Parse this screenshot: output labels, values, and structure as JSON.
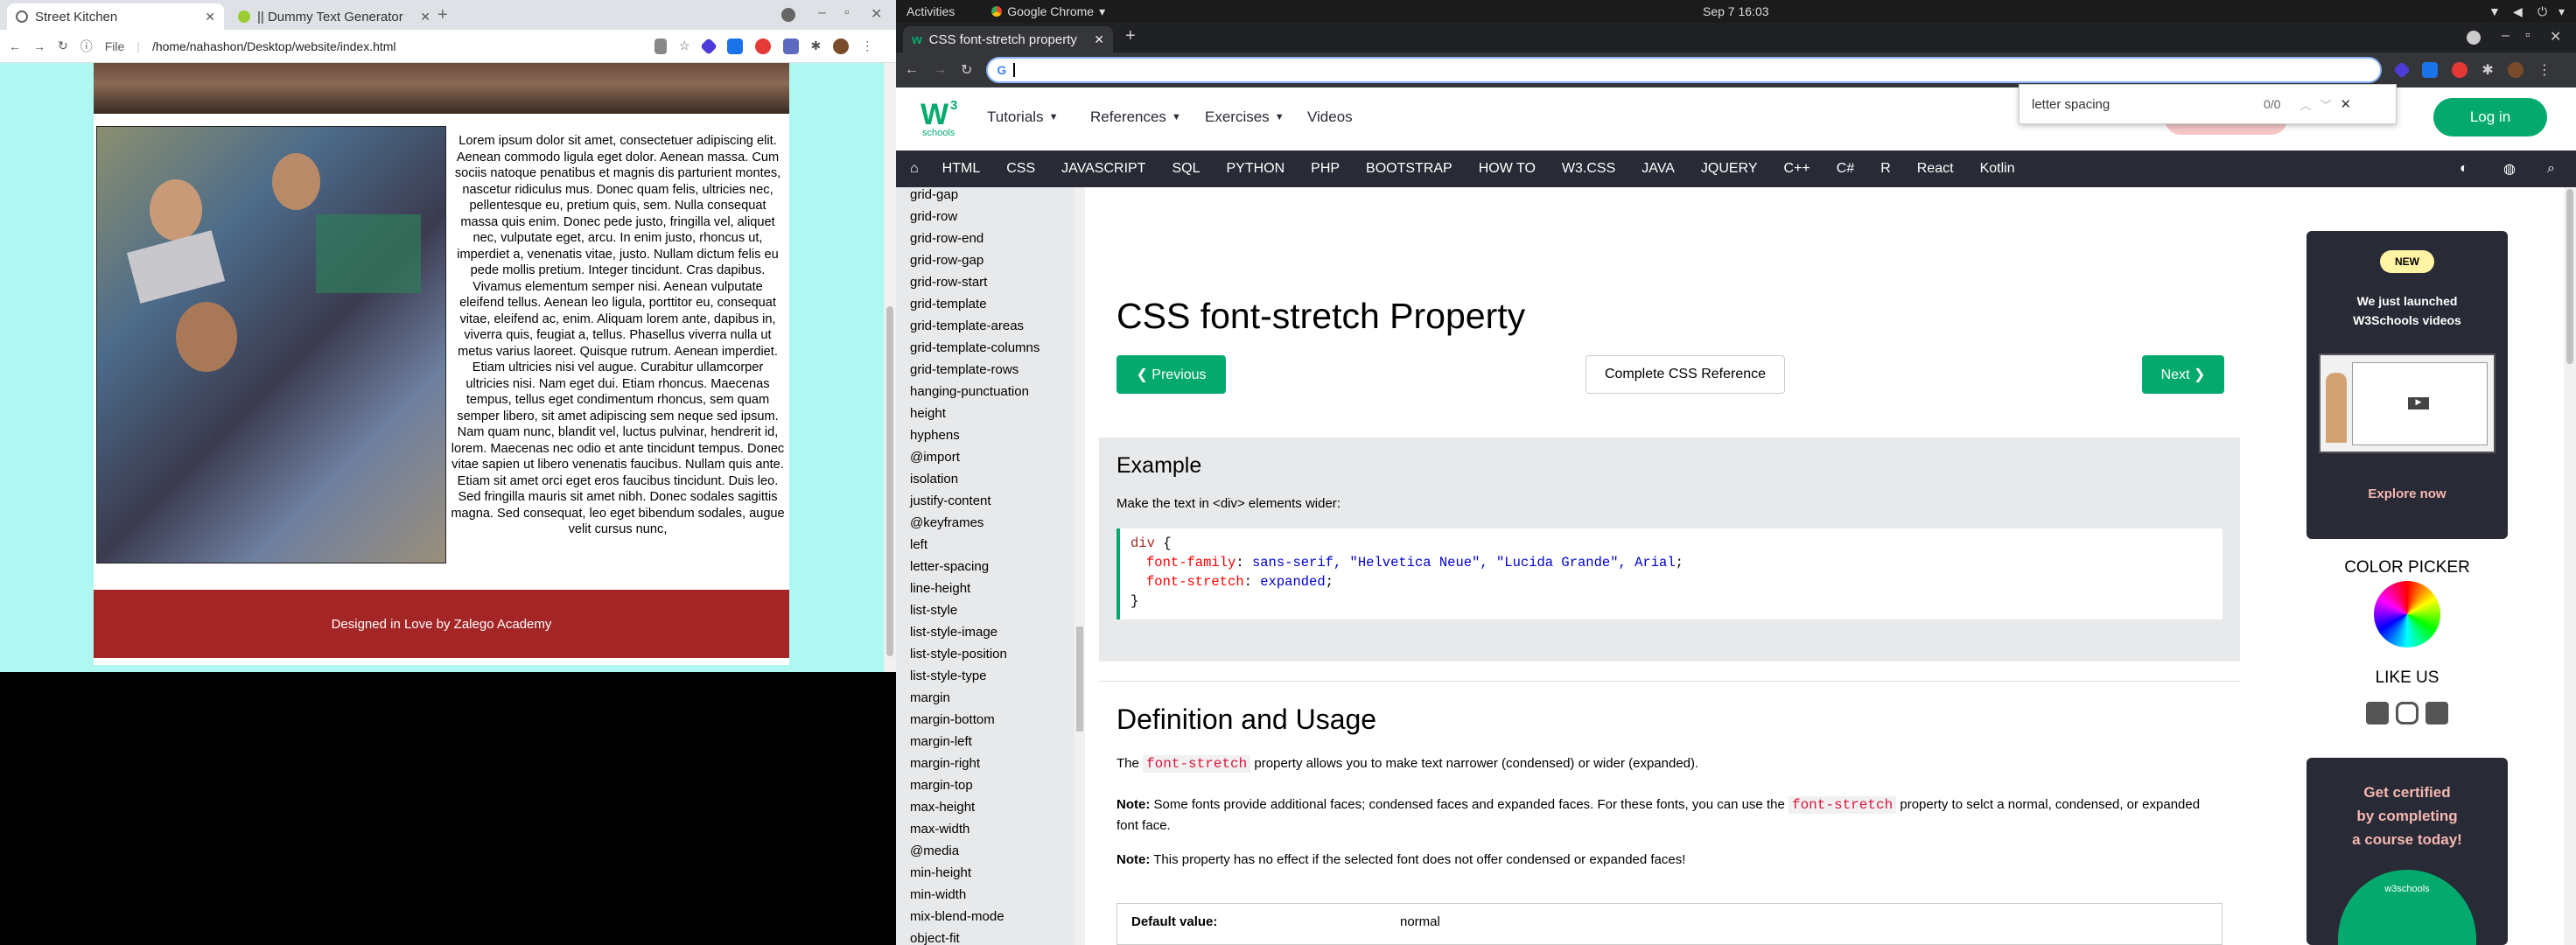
{
  "left_window": {
    "tabs": [
      {
        "title": "Street Kitchen"
      },
      {
        "title": "|| Dummy Text Generator"
      }
    ],
    "url_scheme": "File",
    "url": "/home/nahashon/Desktop/website/index.html",
    "lorem": "Lorem ipsum dolor sit amet, consectetuer adipiscing elit. Aenean commodo ligula eget dolor. Aenean massa. Cum sociis natoque penatibus et magnis dis parturient montes, nascetur ridiculus mus. Donec quam felis, ultricies nec, pellentesque eu, pretium quis, sem. Nulla consequat massa quis enim. Donec pede justo, fringilla vel, aliquet nec, vulputate eget, arcu. In enim justo, rhoncus ut, imperdiet a, venenatis vitae, justo. Nullam dictum felis eu pede mollis pretium. Integer tincidunt. Cras dapibus. Vivamus elementum semper nisi. Aenean vulputate eleifend tellus. Aenean leo ligula, porttitor eu, consequat vitae, eleifend ac, enim. Aliquam lorem ante, dapibus in, viverra quis, feugiat a, tellus. Phasellus viverra nulla ut metus varius laoreet. Quisque rutrum. Aenean imperdiet. Etiam ultricies nisi vel augue. Curabitur ullamcorper ultricies nisi. Nam eget dui. Etiam rhoncus. Maecenas tempus, tellus eget condimentum rhoncus, sem quam semper libero, sit amet adipiscing sem neque sed ipsum. Nam quam nunc, blandit vel, luctus pulvinar, hendrerit id, lorem. Maecenas nec odio et ante tincidunt tempus. Donec vitae sapien ut libero venenatis faucibus. Nullam quis ante. Etiam sit amet orci eget eros faucibus tincidunt. Duis leo. Sed fringilla mauris sit amet nibh. Donec sodales sagittis magna. Sed consequat, leo eget bibendum sodales, augue velit cursus nunc,",
    "footer": "Designed in Love by Zalego Academy"
  },
  "topbar": {
    "activities": "Activities",
    "app": "Google Chrome",
    "datetime": "Sep 7  16:03"
  },
  "right_window": {
    "tab_title": "CSS font-stretch property",
    "find": {
      "query": "letter spacing",
      "count": "0/0"
    },
    "logo": {
      "main": "W",
      "sup": "3",
      "sub": "schools"
    },
    "menus": [
      "Tutorials",
      "References",
      "Exercises",
      "Videos"
    ],
    "login": "Log in",
    "nav": [
      "HTML",
      "CSS",
      "JAVASCRIPT",
      "SQL",
      "PYTHON",
      "PHP",
      "BOOTSTRAP",
      "HOW TO",
      "W3.CSS",
      "JAVA",
      "JQUERY",
      "C++",
      "C#",
      "R",
      "React",
      "Kotlin"
    ],
    "sidebar": [
      "grid-gap",
      "grid-row",
      "grid-row-end",
      "grid-row-gap",
      "grid-row-start",
      "grid-template",
      "grid-template-areas",
      "grid-template-columns",
      "grid-template-rows",
      "hanging-punctuation",
      "height",
      "hyphens",
      "@import",
      "isolation",
      "justify-content",
      "@keyframes",
      "left",
      "letter-spacing",
      "line-height",
      "list-style",
      "list-style-image",
      "list-style-position",
      "list-style-type",
      "margin",
      "margin-bottom",
      "margin-left",
      "margin-right",
      "margin-top",
      "max-height",
      "max-width",
      "@media",
      "min-height",
      "min-width",
      "mix-blend-mode",
      "object-fit"
    ],
    "page": {
      "title": "CSS font-stretch Property",
      "prev": "❮ Previous",
      "ref": "Complete CSS Reference",
      "next": "Next ❯",
      "example_title": "Example",
      "example_desc": "Make the text in <div> elements wider:",
      "code": {
        "selector": "div",
        "open": " {",
        "p1": "font-family",
        "v1": "sans-serif, \"Helvetica Neue\", \"Lucida Grande\", Arial",
        "p2": "font-stretch",
        "v2": "expanded",
        "close": "}"
      },
      "def_title": "Definition and Usage",
      "def_p1_pre": "The",
      "def_p1_kw": "font-stretch",
      "def_p1_post": "property allows you to make text narrower (condensed) or wider (expanded).",
      "note1_label": "Note:",
      "note1_pre": "Some fonts provide additional faces; condensed faces and expanded faces. For these fonts, you can use the",
      "note1_kw": "font-stretch",
      "note1_post": "property to selct a normal, condensed, or expanded font face.",
      "note2_label": "Note:",
      "note2": "This property has no effect if the selected font does not offer condensed or expanded faces!",
      "table": {
        "label": "Default value:",
        "value": "normal"
      }
    },
    "right_col": {
      "badge": "NEW",
      "ad_text1": "We just launched",
      "ad_text2": "W3Schools videos",
      "explore": "Explore now",
      "color_picker": "COLOR PICKER",
      "like_us": "LIKE US",
      "cert1": "Get certified",
      "cert2": "by completing",
      "cert3": "a course today!",
      "cert_logo": "w3schools"
    }
  }
}
